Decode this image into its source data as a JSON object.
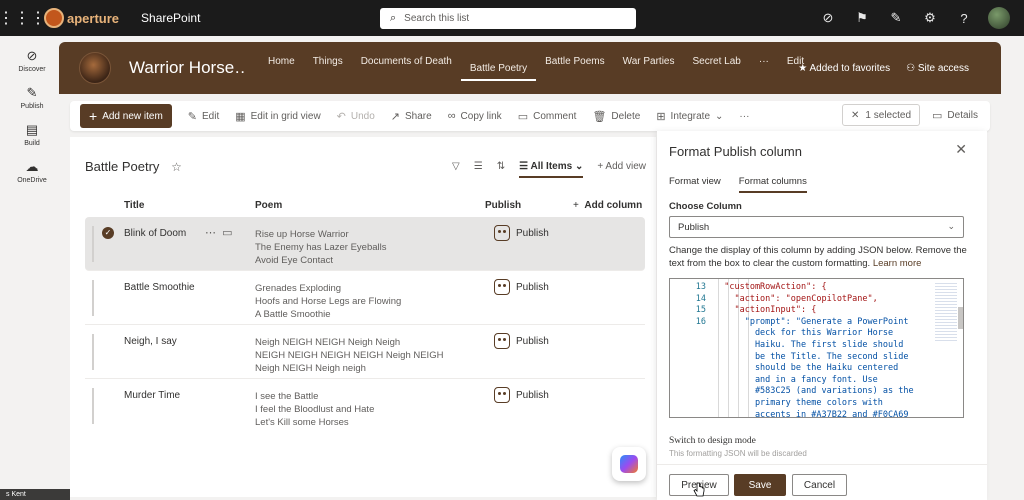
{
  "suite": {
    "logo_text": "aperture",
    "app_name": "SharePoint",
    "search_placeholder": "Search this list"
  },
  "rail": {
    "items": [
      {
        "label": "Discover",
        "icon": "compass-icon"
      },
      {
        "label": "Publish",
        "icon": "pen-icon"
      },
      {
        "label": "Build",
        "icon": "build-icon"
      },
      {
        "label": "OneDrive",
        "icon": "cloud-icon"
      }
    ]
  },
  "site": {
    "title": "Warrior Horse…",
    "nav": [
      "Home",
      "Things",
      "Documents of Death",
      "Battle Poetry",
      "Battle Poems",
      "War Parties",
      "Secret Lab",
      "···",
      "Edit"
    ],
    "active_nav": "Battle Poetry",
    "favorites_label": "Added to favorites",
    "access_label": "Site access"
  },
  "commands": {
    "new_item": "Add new item",
    "edit": "Edit",
    "grid_view": "Edit in grid view",
    "undo": "Undo",
    "share": "Share",
    "copy_link": "Copy link",
    "comment": "Comment",
    "delete": "Delete",
    "integrate": "Integrate",
    "more": "···",
    "selected": "1 selected",
    "details": "Details"
  },
  "list": {
    "title": "Battle Poetry",
    "view_name": "All Items",
    "add_view": "Add view",
    "columns": {
      "title": "Title",
      "poem": "Poem",
      "publish": "Publish",
      "add_column": "Add column"
    },
    "rows": [
      {
        "title": "Blink of Doom",
        "poem": [
          "Rise up Horse Warrior",
          "The Enemy has Lazer Eyeballs",
          "Avoid Eye Contact"
        ],
        "publish": "Publish",
        "selected": true
      },
      {
        "title": "Battle Smoothie",
        "poem": [
          "Grenades Exploding",
          "Hoofs and Horse Legs are Flowing",
          "A Battle Smoothie"
        ],
        "publish": "Publish",
        "selected": false
      },
      {
        "title": "Neigh, I say",
        "poem": [
          "Neigh NEIGH NEIGH Neigh Neigh",
          "NEIGH NEIGH NEIGH NEIGH Neigh NEIGH",
          "Neigh NEIGH Neigh neigh"
        ],
        "publish": "Publish",
        "selected": false
      },
      {
        "title": "Murder Time",
        "poem": [
          "I see the Battle",
          "I feel the Bloodlust and Hate",
          "Let's Kill some Horses"
        ],
        "publish": "Publish",
        "selected": false
      }
    ]
  },
  "panel": {
    "title": "Format Publish column",
    "tabs": [
      "Format view",
      "Format columns"
    ],
    "active_tab": "Format columns",
    "choose_label": "Choose Column",
    "column_value": "Publish",
    "description": "Change the display of this column by adding JSON below. Remove the text from the box to clear the custom formatting.",
    "learn_more": "Learn more",
    "code_lines": [
      {
        "n": "13",
        "text": "  \"customRowAction\": {"
      },
      {
        "n": "14",
        "text": "    \"action\": \"openCopilotPane\","
      },
      {
        "n": "15",
        "text": "    \"actionInput\": {"
      },
      {
        "n": "16",
        "text": "      \"prompt\": \"Generate a PowerPoint"
      },
      {
        "n": "",
        "text": "        deck for this Warrior Horse"
      },
      {
        "n": "",
        "text": "        Haiku. The first slide should"
      },
      {
        "n": "",
        "text": "        be the Title. The second slide"
      },
      {
        "n": "",
        "text": "        should be the Haiku centered"
      },
      {
        "n": "",
        "text": "        and in a fancy font. Use"
      },
      {
        "n": "",
        "text": "        #583C25 (and variations) as the"
      },
      {
        "n": "",
        "text": "        primary theme colors with"
      },
      {
        "n": "",
        "text": "        accents in #A37B22 and #F0CA69"
      }
    ],
    "design_mode": "Switch to design mode",
    "design_note": "This formatting JSON will be discarded",
    "preview": "Preview",
    "save": "Save",
    "cancel": "Cancel"
  },
  "taskbar": {
    "text": "s Kent"
  },
  "colors": {
    "brand": "#583C25",
    "accent1": "#A37B22",
    "accent2": "#F0CA69"
  }
}
